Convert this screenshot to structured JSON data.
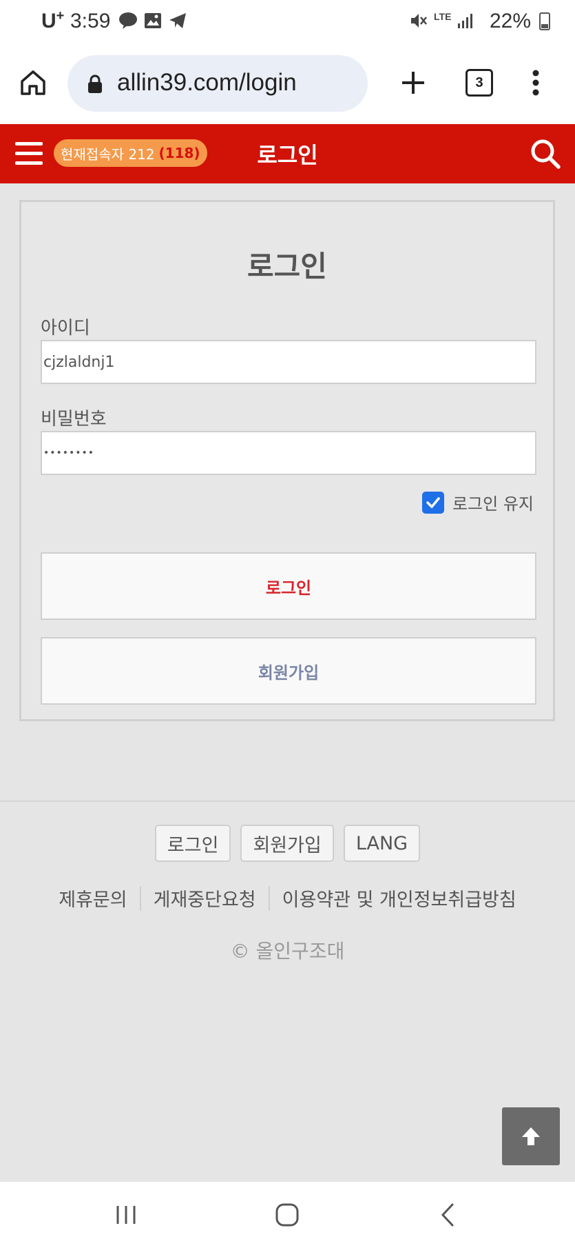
{
  "status_bar": {
    "carrier": "U",
    "carrier_sup": "+",
    "time": "3:59",
    "battery_percent": "22%",
    "network": "LTE"
  },
  "browser": {
    "url": "allin39.com/login",
    "tab_count": "3"
  },
  "header": {
    "visitors_label": "현재접속자 212",
    "visitors_member_count": "(118)",
    "title": "로그인"
  },
  "login_form": {
    "title": "로그인",
    "id_label": "아이디",
    "id_value": "cjzlaldnj1",
    "password_label": "비밀번호",
    "password_value": "••••••••",
    "remember_label": "로그인 유지",
    "remember_checked": true,
    "login_button": "로그인",
    "signup_button": "회원가입"
  },
  "footer": {
    "buttons": [
      "로그인",
      "회원가입",
      "LANG"
    ],
    "links": [
      "제휴문의",
      "게재중단요청",
      "이용약관 및 개인정보취급방침"
    ],
    "copyright": "© 올인구조대"
  },
  "colors": {
    "header_bg": "#d11207",
    "badge_bg": "#f59a4a",
    "login_text": "#d8242b",
    "checkbox": "#1f6fe8"
  }
}
